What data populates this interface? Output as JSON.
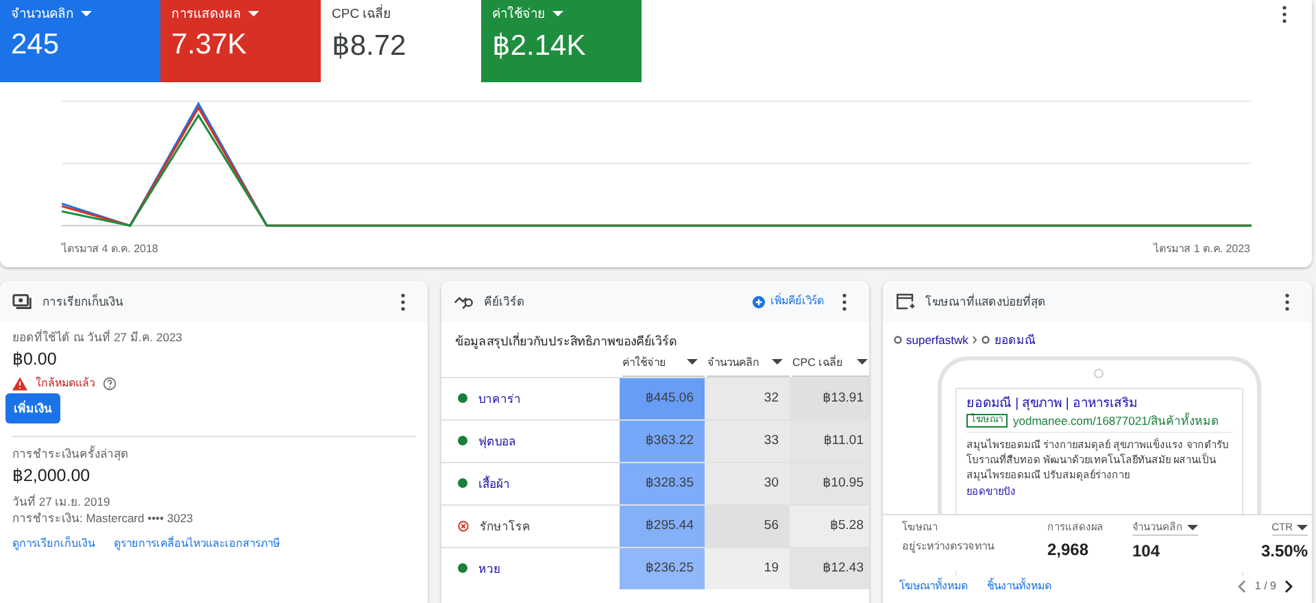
{
  "metrics": [
    {
      "label": "จำนวนคลิก",
      "value": "245",
      "selected": true,
      "color": "#1a73e8"
    },
    {
      "label": "การแสดงผล",
      "value": "7.37K",
      "selected": true,
      "color": "#d93025"
    },
    {
      "label": "CPC เฉลี่ย",
      "value": "฿8.72",
      "selected": false
    },
    {
      "label": "ค่าใช้จ่าย",
      "value": "฿2.14K",
      "selected": true,
      "color": "#1e8e3e"
    }
  ],
  "chart": {
    "start_label": "ไตรมาส 4 ต.ค. 2018",
    "end_label": "ไตรมาส 1 ต.ค. 2023"
  },
  "billing": {
    "title": "การเรียกเก็บเงิน",
    "balance_label": "ยอดที่ใช้ได้ ณ วันที่ 27 มี.ค. 2023",
    "balance": "฿0.00",
    "warning": "ใกล้หมดแล้ว",
    "add_button": "เพิ่มเงิน",
    "last_payment_label": "การชำระเงินครั้งล่าสุด",
    "last_payment": "฿2,000.00",
    "date": "วันที่ 27 เม.ย. 2019",
    "method": "การชำระเงิน: Mastercard •••• 3023",
    "links": [
      "ดูการเรียกเก็บเงิน",
      "ดูรายการเคลื่อนไหวและเอกสารภาษี"
    ]
  },
  "keywords": {
    "title": "คีย์เวิร์ด",
    "add_link": "เพิ่มคีย์เวิร์ด",
    "subtitle": "ข้อมูลสรุปเกี่ยวกับประสิทธิภาพของคีย์เวิร์ด",
    "columns": [
      "ค่าใช้จ่าย",
      "จำนวนคลิก",
      "CPC เฉลี่ย"
    ],
    "rows": [
      {
        "keyword": "บาคาร่า",
        "approved": true,
        "cells": [
          "฿445.06",
          "32",
          "฿13.91"
        ]
      },
      {
        "keyword": "ฟุตบอล",
        "approved": true,
        "cells": [
          "฿363.22",
          "33",
          "฿11.01"
        ]
      },
      {
        "keyword": "เสื้อผ้า",
        "approved": true,
        "cells": [
          "฿328.35",
          "30",
          "฿10.95"
        ]
      },
      {
        "keyword": "รักษาโรค",
        "approved": false,
        "cells": [
          "฿295.44",
          "56",
          "฿5.28"
        ]
      },
      {
        "keyword": "หวย",
        "approved": true,
        "cells": [
          "฿236.25",
          "19",
          "฿12.43"
        ]
      }
    ]
  },
  "ads": {
    "title": "โฆษณาที่แสดงบ่อยที่สุด",
    "breadcrumb": [
      "superfastwk",
      "ยอดมณี"
    ],
    "ad_title": "ยอดมณี | สุขภาพ | อาหารเสริม",
    "ad_badge": "โฆษณา",
    "ad_url": "yodmanee.com/16877021/สินค้าทั้งหมด",
    "ad_description": "สมุนไพรยอดมณี ร่างกายสมดุลย์ สุขภาพแข็งแรง จากตำรับโบราณที่สืบทอด พัฒนาด้วยเทคโนโลยีทันสมัย ผสานเป็นสมุนไพรยอดมณี ปรับสมดุลย์ร่างกาย",
    "ad_sitelink": "ยอดขายปัง",
    "stats": [
      {
        "label": "โฆษณา",
        "value": "อยู่ระหว่างตรวจทาน",
        "sortable": false
      },
      {
        "label": "การแสดงผล",
        "value": "2,968",
        "sortable": false
      },
      {
        "label": "จำนวนคลิก",
        "value": "104",
        "sortable": true
      },
      {
        "label": "CTR",
        "value": "3.50%",
        "sortable": true
      }
    ],
    "links": [
      "โฆษณาทั้งหมด",
      "ชิ้นงานทั้งหมด"
    ],
    "pager": "1 / 9"
  }
}
